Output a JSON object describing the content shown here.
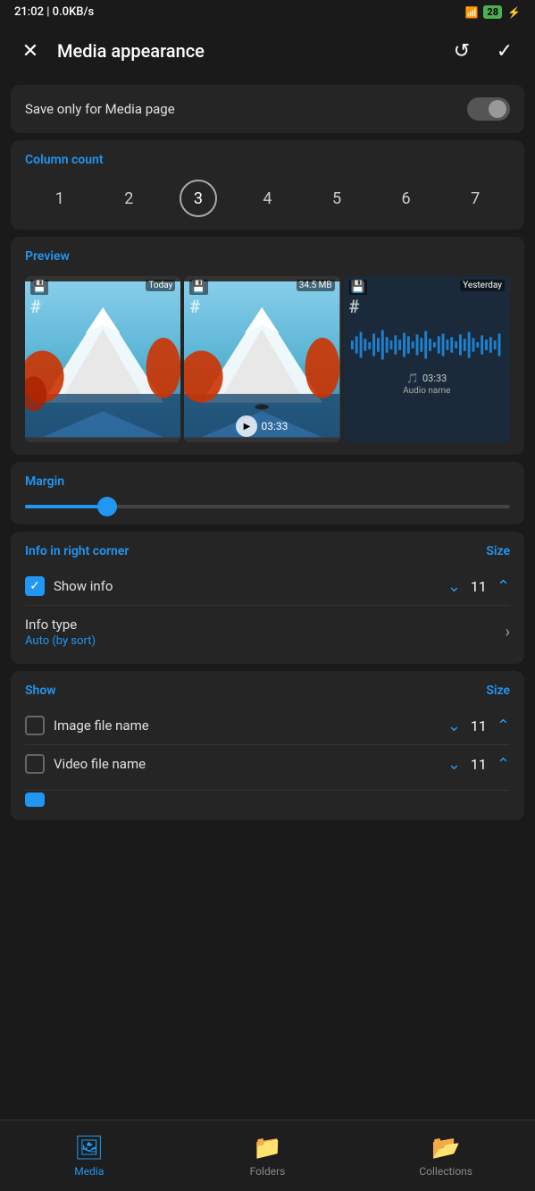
{
  "statusBar": {
    "time": "21:02 | 0.0KB/s",
    "signal": "4G",
    "battery": "28"
  },
  "topBar": {
    "title": "Media appearance",
    "closeIcon": "✕",
    "resetIcon": "↺",
    "confirmIcon": "✓"
  },
  "saveToggle": {
    "label": "Save only for Media page"
  },
  "columnCount": {
    "title": "Column count",
    "values": [
      "1",
      "2",
      "3",
      "4",
      "5",
      "6",
      "7"
    ],
    "selected": 2
  },
  "preview": {
    "title": "Preview",
    "cell1": {
      "badge": "Today"
    },
    "cell2": {
      "badge": "34.5 MB",
      "duration": "03:33"
    },
    "cell3": {
      "badge": "Yesterday",
      "duration": "03:33",
      "audioName": "Audio name"
    }
  },
  "margin": {
    "title": "Margin",
    "value": 18
  },
  "infoCorner": {
    "title": "Info in right corner",
    "sizeLabel": "Size",
    "showInfo": "Show info",
    "showInfoSize": "11",
    "infoType": "Info type",
    "infoTypeSub": "Auto (by sort)"
  },
  "show": {
    "title": "Show",
    "sizeLabel": "Size",
    "items": [
      {
        "label": "Image file name",
        "checked": false,
        "size": "11"
      },
      {
        "label": "Video file name",
        "checked": false,
        "size": "11"
      }
    ]
  },
  "bottomNav": {
    "items": [
      {
        "icon": "🖼",
        "label": "Media",
        "active": true
      },
      {
        "icon": "📁",
        "label": "Folders",
        "active": false
      },
      {
        "icon": "📂",
        "label": "Collections",
        "active": false
      }
    ]
  }
}
